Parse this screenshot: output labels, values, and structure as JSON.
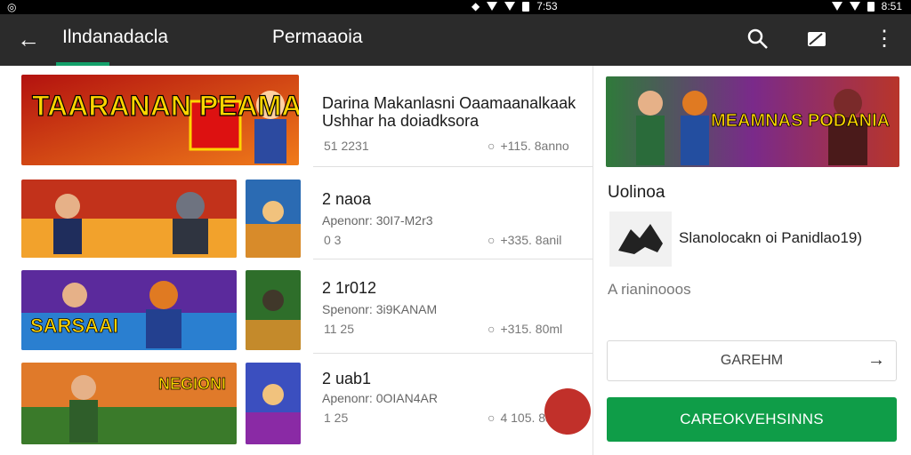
{
  "statusbar": {
    "left_icon": "circle-icon",
    "time_right": "8:51",
    "time_mid": "7:53"
  },
  "appbar": {
    "back": "back-arrow-icon",
    "tab1": "Ilndanadacla",
    "tab2": "Permaaoia",
    "icons": [
      "search-icon",
      "cast-icon",
      "more-vert-icon"
    ]
  },
  "list": [
    {
      "title_line1": "Darina Makanlasni Oaamaanalkaak",
      "title_line2": "Ushhar ha doiadksora",
      "sub": "",
      "meta_left": "51 2231",
      "meta_right": "+115. 8anno",
      "banner_text": "TAARANAN PEAMAISI"
    },
    {
      "title_line1": "2 naoa",
      "title_line2": "",
      "sub": "Apenonr: 30I7-M2r3",
      "meta_left": "0 3",
      "meta_right": "+335. 8anil",
      "banner_text": ""
    },
    {
      "title_line1": "2 1r012",
      "title_line2": "",
      "sub": "Spenonr: 3i9KANAM",
      "meta_left": "11 25",
      "meta_right": "+315. 80ml",
      "banner_text": "SARSAAI"
    },
    {
      "title_line1": "2 uab1",
      "title_line2": "",
      "sub": "Apenonr: 0OIAN4AR",
      "meta_left": "1 25",
      "meta_right": "4 105. 8ann",
      "banner_text": "NEGIONI"
    }
  ],
  "panel": {
    "banner_text": "MEAMNAS PODANIA",
    "section_title": "Uolinoa",
    "developer": "Slanolocakn oi Panidlao19)",
    "muted": "A rianinooos",
    "outline_btn": "GAREHM",
    "primary_btn": "CAREOKVEHSINNS"
  },
  "colors": {
    "accent": "#13a06a",
    "primary_button": "#0f9d48",
    "appbar": "#2b2b2b",
    "fab": "#c1302a"
  }
}
